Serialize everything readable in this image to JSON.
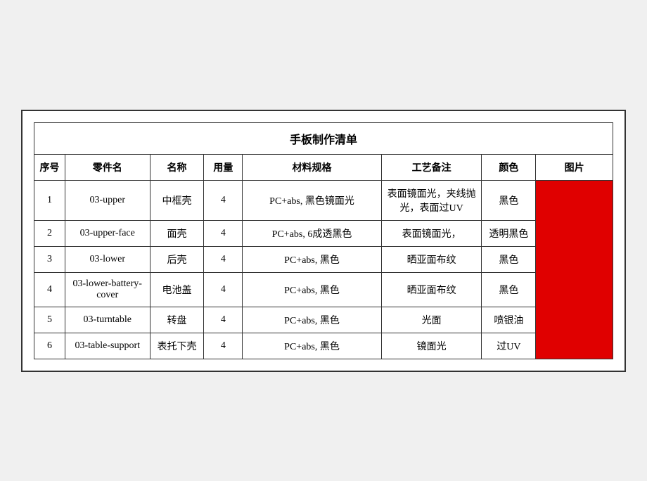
{
  "title": "手板制作清单",
  "headers": {
    "seq": "序号",
    "part": "零件名",
    "name": "名称",
    "qty": "用量",
    "spec": "材料规格",
    "process": "工艺备注",
    "color": "颜色",
    "img": "图片"
  },
  "rows": [
    {
      "seq": "1",
      "part": "03-upper",
      "name": "中框壳",
      "qty": "4",
      "spec": "PC+abs, 黑色镜面光",
      "process": "表面镜面光，夹线抛光，表面过UV",
      "color": "黑色"
    },
    {
      "seq": "2",
      "part": "03-upper-face",
      "name": "面壳",
      "qty": "4",
      "spec": "PC+abs, 6成透黑色",
      "process": "表面镜面光，",
      "color": "透明黑色"
    },
    {
      "seq": "3",
      "part": "03-lower",
      "name": "后壳",
      "qty": "4",
      "spec": "PC+abs, 黑色",
      "process": "晒亚面布纹",
      "color": "黑色"
    },
    {
      "seq": "4",
      "part": "03-lower-battery-cover",
      "name": "电池盖",
      "qty": "4",
      "spec": "PC+abs, 黑色",
      "process": "晒亚面布纹",
      "color": "黑色"
    },
    {
      "seq": "5",
      "part": "03-turntable",
      "name": "转盘",
      "qty": "4",
      "spec": "PC+abs, 黑色",
      "process": "光面",
      "color": "喷银油"
    },
    {
      "seq": "6",
      "part": "03-table-support",
      "name": "表托下壳",
      "qty": "4",
      "spec": "PC+abs, 黑色",
      "process": "镜面光",
      "color": "过UV"
    }
  ]
}
